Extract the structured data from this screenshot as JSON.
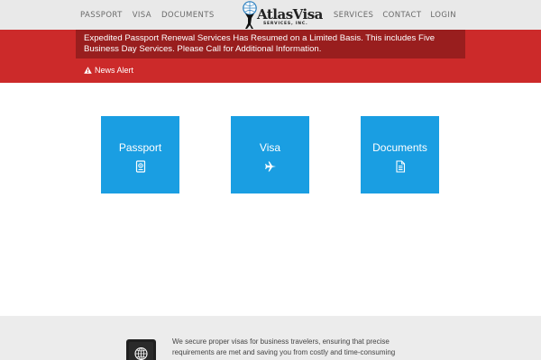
{
  "nav": {
    "left": [
      "PASSPORT",
      "VISA",
      "DOCUMENTS"
    ],
    "right": [
      "SERVICES",
      "CONTACT",
      "LOGIN"
    ]
  },
  "logo": {
    "text": "AtlasVisa",
    "subtitle": "SERVICES, INC."
  },
  "alert": {
    "message": "Expedited Passport Renewal Services Has Resumed on a Limited Basis. This includes Five Business Day Services. Please Call for Additional Information.",
    "news_label": "News Alert"
  },
  "tiles": [
    {
      "label": "Passport",
      "icon": "passport-icon"
    },
    {
      "label": "Visa",
      "icon": "airplane-icon"
    },
    {
      "label": "Documents",
      "icon": "document-icon"
    }
  ],
  "footer": {
    "text": "We secure proper visas for business travelers, ensuring that precise requirements are met and saving you from costly and time-consuming"
  },
  "colors": {
    "nav_bg": "#e9e9e9",
    "alert_red": "#cc2a2a",
    "alert_dark": "#991e1e",
    "tile_blue": "#1a9ee2",
    "footer_bg": "#ececec"
  }
}
